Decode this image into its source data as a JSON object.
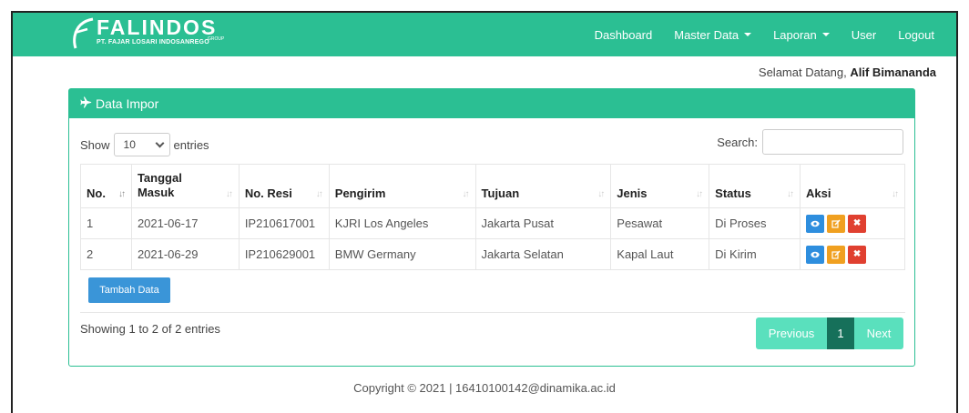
{
  "brand": {
    "name": "FALINDOS",
    "subtitle": "PT. FAJAR LOSARI INDOSANREGO",
    "group": "GROUP"
  },
  "nav": {
    "dashboard": "Dashboard",
    "master_data": "Master Data",
    "laporan": "Laporan",
    "user": "User",
    "logout": "Logout"
  },
  "welcome": {
    "greeting": "Selamat Datang,",
    "user_name": "Alif Bimananda"
  },
  "panel": {
    "title": "Data Impor",
    "icon": "plane-icon"
  },
  "controls": {
    "show_label": "Show",
    "entries_value": "10",
    "entries_label": "entries",
    "search_label": "Search:",
    "search_value": ""
  },
  "table": {
    "headers": [
      "No.",
      "Tanggal Masuk",
      "No. Resi",
      "Pengirim",
      "Tujuan",
      "Jenis",
      "Status",
      "Aksi"
    ],
    "rows": [
      {
        "no": "1",
        "tanggal": "2021-06-17",
        "resi": "IP210617001",
        "pengirim": "KJRI Los Angeles",
        "tujuan": "Jakarta Pusat",
        "jenis": "Pesawat",
        "status": "Di Proses"
      },
      {
        "no": "2",
        "tanggal": "2021-06-29",
        "resi": "IP210629001",
        "pengirim": "BMW Germany",
        "tujuan": "Jakarta Selatan",
        "jenis": "Kapal Laut",
        "status": "Di Kirim"
      }
    ]
  },
  "actions": {
    "tambah": "Tambah Data",
    "view_icon": "eye-icon",
    "edit_icon": "edit-icon",
    "delete_icon": "close-icon"
  },
  "info": "Showing 1 to 2 of 2 entries",
  "pagination": {
    "previous": "Previous",
    "current": "1",
    "next": "Next"
  },
  "footer": "Copyright © 2021 | 16410100142@dinamika.ac.id",
  "colors": {
    "primary": "#2bbf93",
    "pager_light": "#5ae0bd",
    "pager_active": "#16705a",
    "view": "#2e8ede",
    "edit": "#f0a020",
    "delete": "#e04030",
    "tambah": "#3a95d8"
  }
}
